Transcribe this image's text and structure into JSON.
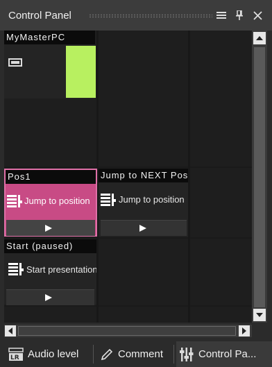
{
  "window": {
    "title": "Control Panel",
    "icons": [
      "menu-icon",
      "pin-icon",
      "close-icon"
    ]
  },
  "grid": {
    "cells": [
      {
        "header": "MyMasterPC",
        "type": "computer",
        "indicator_color": "#b8f060"
      },
      {
        "header": "Pos1",
        "text": "Jump to position",
        "state": "active",
        "highlight_color": "#c84b85"
      },
      {
        "header": "Jump to NEXT Position",
        "text": "Jump to position"
      },
      {
        "header": "Start  (paused)",
        "text": "Start presentation"
      }
    ]
  },
  "tabs": [
    {
      "label": "Audio level",
      "icon": "audio-level-icon"
    },
    {
      "label": "Comment",
      "icon": "pencil-icon"
    },
    {
      "label": "Control Pa...",
      "icon": "control-panel-icon",
      "active": true
    }
  ]
}
